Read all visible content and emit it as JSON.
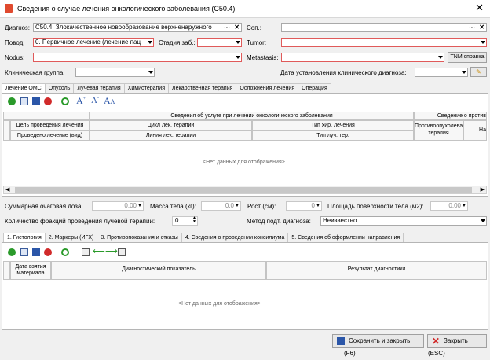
{
  "window": {
    "title": "Сведения о случае лечения онкологического заболевания (C50.4)"
  },
  "form": {
    "diagnosis_label": "Диагноз:",
    "diagnosis_value": "C50.4. Злокачественное новообразование верхненаружного",
    "con_label": "Соп.:",
    "reason_label": "Повод:",
    "reason_value": "0. Первичное лечение (лечение пац",
    "stage_label": "Стадия заб.:",
    "tumor_label": "Tumor:",
    "nodus_label": "Nodus:",
    "metastasis_label": "Metastasis:",
    "tnm_button": "TNM справка",
    "clinical_group_label": "Клиническая группа:",
    "clinical_date_label": "Дата установления клинического диагноза:",
    "ellipsis": "···"
  },
  "main_tabs": [
    "Лечение ОМС",
    "Опухоль",
    "Лучевая терапия",
    "Химиотерапия",
    "Лекарственная терапия",
    "Осложнения лечения",
    "Операция"
  ],
  "grid1": {
    "group_header_1": "Сведения об услуге при лечении онкологического заболевания",
    "group_header_2": "Сведение о против",
    "col_a1": "Цель проведения лечения",
    "col_a2": "Проведено лечение (вид)",
    "col_b1": "Цикл лек. терапии",
    "col_b2": "Линия лек. терапии",
    "col_c1": "Тип хир. лечения",
    "col_c2": "Тип луч. тер.",
    "col_d": "Противоопухолевая терапия",
    "col_e": "На",
    "empty_text": "<Нет данных для отображения>"
  },
  "metrics": {
    "total_dose_label": "Суммарная очаговая доза:",
    "total_dose_value": "0,00",
    "mass_label": "Масса тела (кг):",
    "mass_value": "0,0",
    "height_label": "Рост (см):",
    "height_value": "0",
    "area_label": "Площадь поверхности тела (м2):",
    "area_value": "0,00",
    "fractions_label": "Количество фракций проведения лучевой терапии:",
    "fractions_value": "0",
    "method_label": "Метод подт. диагноза:",
    "method_value": "Неизвестно"
  },
  "sub_tabs": [
    "1. Гистология",
    "2. Маркеры (ИГХ)",
    "3. Противопоказания и отказы",
    "4. Сведения о проведении консилиума",
    "5. Сведения об оформлении направления"
  ],
  "grid2": {
    "col_date": "Дата взятия материала",
    "col_indicator": "Диагностический показатель",
    "col_result": "Результат диагностики",
    "empty_text": "<Нет данных для отображения>"
  },
  "footer": {
    "save_close": "Сохранить и закрыть (F6)",
    "close": "Закрыть (ESC)"
  }
}
